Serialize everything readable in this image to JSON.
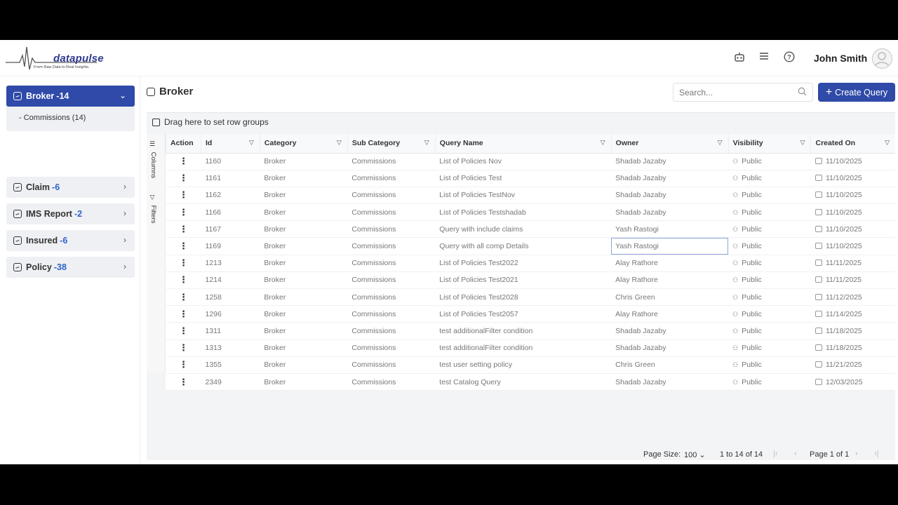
{
  "brand": {
    "name": "datapulse",
    "tagline": "From Raw Data to Real Insights."
  },
  "header": {
    "user_name": "John Smith",
    "icons": [
      "robot-icon",
      "menu-icon",
      "help-icon"
    ]
  },
  "sidebar": {
    "items": [
      {
        "label": "Broker",
        "count": "-14",
        "active": true
      },
      {
        "label": "Claim",
        "count": "-6"
      },
      {
        "label": "IMS Report",
        "count": "-2"
      },
      {
        "label": "Insured",
        "count": "-6"
      },
      {
        "label": "Policy",
        "count": "-38"
      }
    ],
    "sub_item": "- Commissions (14)"
  },
  "main": {
    "title": "Broker",
    "search_placeholder": "Search...",
    "create_label": "Create Query",
    "row_group_label": "Drag here to set row groups",
    "side_tabs": [
      "Columns",
      "Filters"
    ]
  },
  "table": {
    "columns": [
      "Action",
      "Id",
      "Category",
      "Sub Category",
      "Query Name",
      "Owner",
      "Visibility",
      "Created On"
    ],
    "rows": [
      [
        "1160",
        "Broker",
        "Commissions",
        "List of Policies Nov",
        "Shadab Jazaby",
        "Public",
        "11/10/2025"
      ],
      [
        "1161",
        "Broker",
        "Commissions",
        "List of Policies Test",
        "Shadab Jazaby",
        "Public",
        "11/10/2025"
      ],
      [
        "1162",
        "Broker",
        "Commissions",
        "List of Policies TestNov",
        "Shadab Jazaby",
        "Public",
        "11/10/2025"
      ],
      [
        "1166",
        "Broker",
        "Commissions",
        "List of Policies Testshadab",
        "Shadab Jazaby",
        "Public",
        "11/10/2025"
      ],
      [
        "1167",
        "Broker",
        "Commissions",
        "Query with include claims",
        "Yash Rastogi",
        "Public",
        "11/10/2025"
      ],
      [
        "1169",
        "Broker",
        "Commissions",
        "Query with all comp Details",
        "Yash Rastogi",
        "Public",
        "11/10/2025"
      ],
      [
        "1213",
        "Broker",
        "Commissions",
        "List of Policies Test2022",
        "Alay Rathore",
        "Public",
        "11/11/2025"
      ],
      [
        "1214",
        "Broker",
        "Commissions",
        "List of Policies Test2021",
        "Alay Rathore",
        "Public",
        "11/11/2025"
      ],
      [
        "1258",
        "Broker",
        "Commissions",
        "List of Policies Test2028",
        "Chris Green",
        "Public",
        "11/12/2025"
      ],
      [
        "1296",
        "Broker",
        "Commissions",
        "List of Policies Test2057",
        "Alay Rathore",
        "Public",
        "11/14/2025"
      ],
      [
        "1311",
        "Broker",
        "Commissions",
        "test additionalFilter condition",
        "Shadab Jazaby",
        "Public",
        "11/18/2025"
      ],
      [
        "1313",
        "Broker",
        "Commissions",
        "test additionalFilter condition",
        "Shadab Jazaby",
        "Public",
        "11/18/2025"
      ],
      [
        "1355",
        "Broker",
        "Commissions",
        "test user setting policy",
        "Chris Green",
        "Public",
        "11/21/2025"
      ],
      [
        "2349",
        "Broker",
        "Commissions",
        "test Catalog Query",
        "Shadab Jazaby",
        "Public",
        "12/03/2025"
      ]
    ],
    "selected_row": 5
  },
  "pager": {
    "page_size_label": "Page Size:",
    "page_size_value": "100",
    "range": "1 to 14 of 14",
    "page_label": "Page 1 of 1"
  },
  "colors": {
    "accent": "#2f4aa8",
    "count": "#2f63c7"
  }
}
